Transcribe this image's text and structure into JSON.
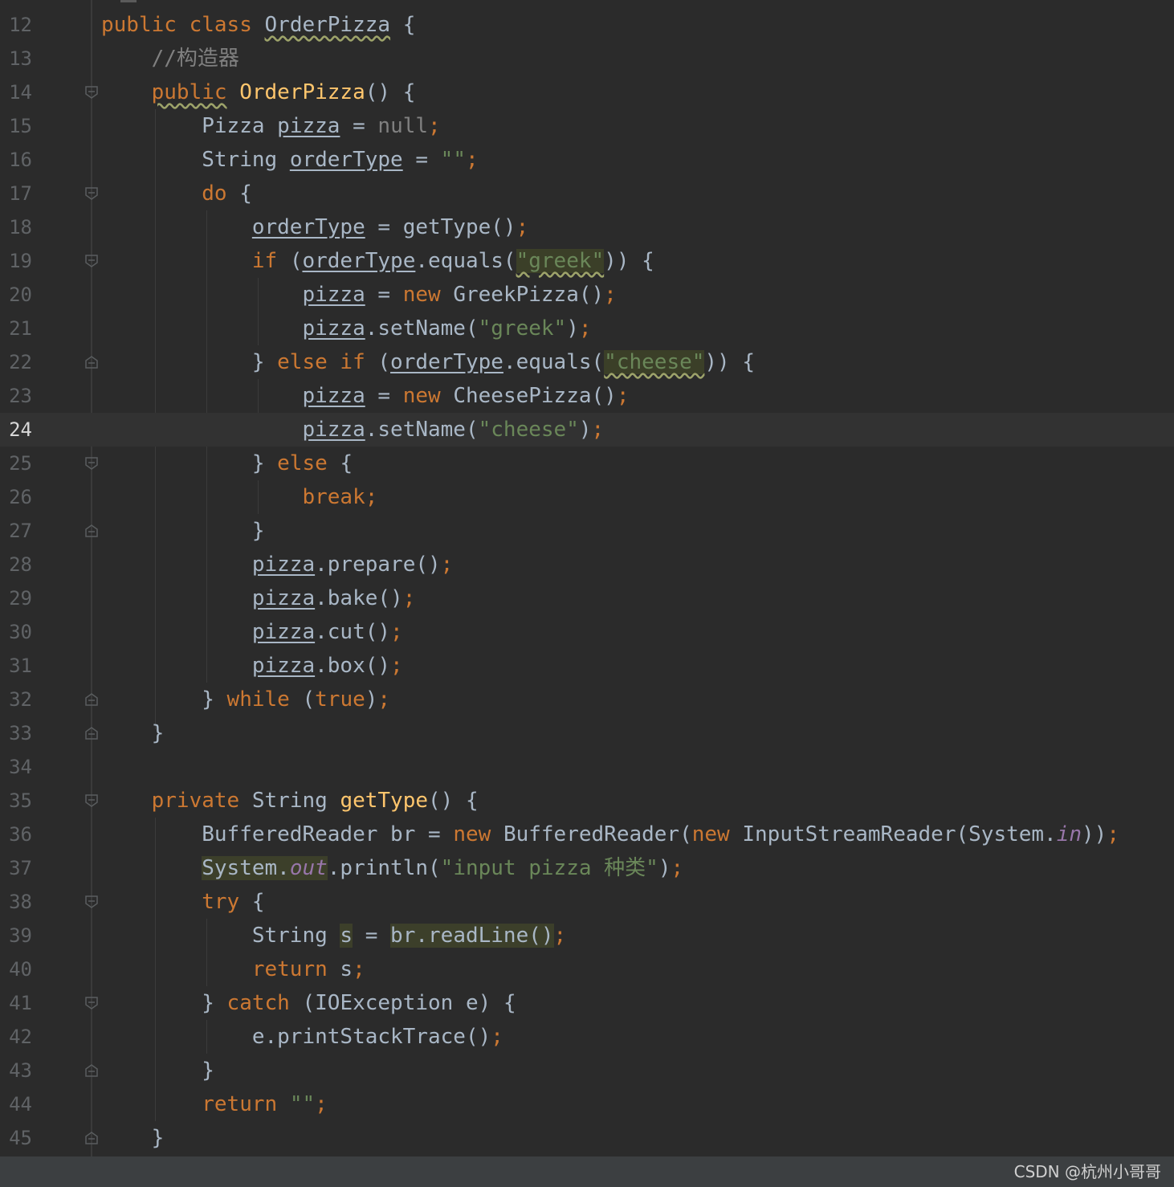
{
  "editor": {
    "current_line": "24",
    "lines": [
      {
        "n": "12",
        "t": {
          "a": "public",
          "b": "class",
          "c": "OrderPizza",
          "d": "{"
        }
      },
      {
        "n": "13",
        "t": {
          "a": "//构造器"
        }
      },
      {
        "n": "14",
        "t": {
          "a": "public",
          "b": "OrderPizza",
          "c": "()",
          "d": "{"
        }
      },
      {
        "n": "15",
        "t": {
          "a": "Pizza",
          "b": "pizza",
          "c": "=",
          "d": "null",
          "e": ";"
        }
      },
      {
        "n": "16",
        "t": {
          "a": "String",
          "b": "orderType",
          "c": "=",
          "d": "\"\"",
          "e": ";"
        }
      },
      {
        "n": "17",
        "t": {
          "a": "do",
          "b": "{"
        }
      },
      {
        "n": "18",
        "t": {
          "a": "orderType",
          "b": "= getType()",
          "c": ";"
        }
      },
      {
        "n": "19",
        "t": {
          "a": "if",
          "b": "(",
          "c": "orderType",
          "d": ".equals(",
          "e": "\"greek\"",
          "f": ")) {"
        }
      },
      {
        "n": "20",
        "t": {
          "a": "pizza",
          "b": "=",
          "c": "new",
          "d": "GreekPizza()",
          "e": ";"
        }
      },
      {
        "n": "21",
        "t": {
          "a": "pizza",
          "b": ".setName(",
          "c": "\"greek\"",
          "d": ")",
          "e": ";"
        }
      },
      {
        "n": "22",
        "t": {
          "a": "}",
          "b": "else if",
          "c": "(",
          "d": "orderType",
          "e": ".equals(",
          "f": "\"cheese\"",
          "g": ")) {"
        }
      },
      {
        "n": "23",
        "t": {
          "a": "pizza",
          "b": "=",
          "c": "new",
          "d": "CheesePizza()",
          "e": ";"
        }
      },
      {
        "n": "24",
        "t": {
          "a": "pizza",
          "b": ".setName(",
          "c": "\"cheese\"",
          "d": ")",
          "e": ";"
        }
      },
      {
        "n": "25",
        "t": {
          "a": "}",
          "b": "else",
          "c": "{"
        }
      },
      {
        "n": "26",
        "t": {
          "a": "break",
          "b": ";"
        }
      },
      {
        "n": "27",
        "t": {
          "a": "}"
        }
      },
      {
        "n": "28",
        "t": {
          "a": "pizza",
          "b": ".prepare()",
          "c": ";"
        }
      },
      {
        "n": "29",
        "t": {
          "a": "pizza",
          "b": ".bake()",
          "c": ";"
        }
      },
      {
        "n": "30",
        "t": {
          "a": "pizza",
          "b": ".cut()",
          "c": ";"
        }
      },
      {
        "n": "31",
        "t": {
          "a": "pizza",
          "b": ".box()",
          "c": ";"
        }
      },
      {
        "n": "32",
        "t": {
          "a": "}",
          "b": "while",
          "c": "(",
          "d": "true",
          "e": ")",
          "f": ";"
        }
      },
      {
        "n": "33",
        "t": {
          "a": "}"
        }
      },
      {
        "n": "34",
        "t": {}
      },
      {
        "n": "35",
        "t": {
          "a": "private",
          "b": "String",
          "c": "getType",
          "d": "()",
          "e": "{"
        }
      },
      {
        "n": "36",
        "t": {
          "a": "BufferedReader br =",
          "b": "new",
          "c": "BufferedReader(",
          "d": "new",
          "e": "InputStreamReader(System.",
          "f": "in",
          "g": "))",
          "h": ";"
        }
      },
      {
        "n": "37",
        "t": {
          "a": "System.",
          "b": "out",
          "c": ".println(",
          "d": "\"input pizza 种类\"",
          "e": ")",
          "f": ";"
        }
      },
      {
        "n": "38",
        "t": {
          "a": "try",
          "b": "{"
        }
      },
      {
        "n": "39",
        "t": {
          "a": "String",
          "b": "s",
          "c": "=",
          "d": "br.readLine()",
          "e": ";"
        }
      },
      {
        "n": "40",
        "t": {
          "a": "return",
          "b": "s",
          "c": ";"
        }
      },
      {
        "n": "41",
        "t": {
          "a": "}",
          "b": "catch",
          "c": "(IOException e) {"
        }
      },
      {
        "n": "42",
        "t": {
          "a": "e.printStackTrace()",
          "b": ";"
        }
      },
      {
        "n": "43",
        "t": {
          "a": "}"
        }
      },
      {
        "n": "44",
        "t": {
          "a": "return",
          "b": "\"\"",
          "c": ";"
        }
      },
      {
        "n": "45",
        "t": {
          "a": "}"
        }
      }
    ]
  },
  "footer": {
    "watermark": "CSDN @杭州小哥哥"
  },
  "colors": {
    "background": "#2b2b2b",
    "keyword": "#cc7832",
    "function": "#ffc66d",
    "string": "#6a8759",
    "comment": "#808080",
    "static_field": "#9876aa",
    "default_text": "#a9b7c6",
    "line_number": "#606366"
  }
}
